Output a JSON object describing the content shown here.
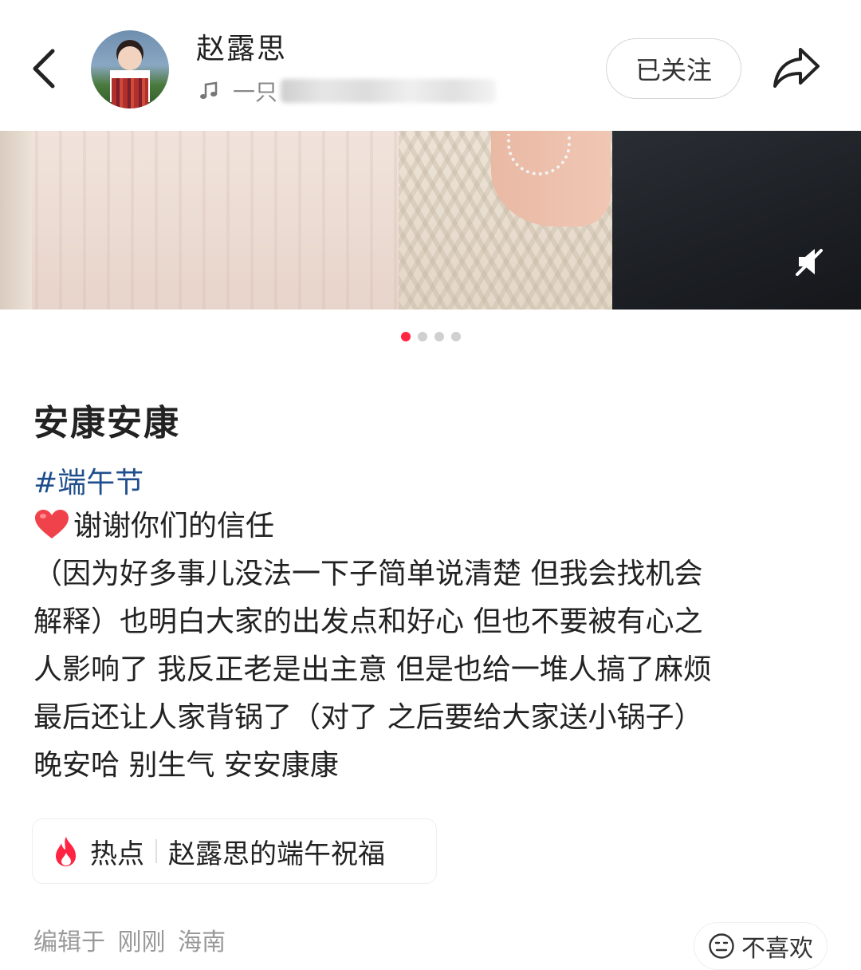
{
  "header": {
    "username": "赵露思",
    "music_prefix": "一只",
    "follow_label": "已关注"
  },
  "carousel": {
    "total": 4,
    "active_index": 0
  },
  "post": {
    "title": "安康安康",
    "hashtag": "#端午节",
    "lines": [
      "谢谢你们的信任",
      "（因为好多事儿没法一下子简单说清楚 但我会找机会",
      "解释）也明白大家的出发点和好心 但也不要被有心之",
      "人影响了 我反正老是出主意 但是也给一堆人搞了麻烦",
      "最后还让人家背锅了（对了 之后要给大家送小锅子）",
      "晚安哈 别生气 安安康康"
    ]
  },
  "hot": {
    "label": "热点",
    "topic": "赵露思的端午祝福"
  },
  "meta": {
    "text": "编辑于 刚刚 海南"
  },
  "dislike": {
    "label": "不喜欢"
  },
  "colors": {
    "accent": "#ff2442",
    "hashtag": "#1f4e8c"
  },
  "icons": [
    "back-arrow-icon",
    "music-note-icon",
    "share-icon",
    "mute-icon",
    "heart-icon",
    "fire-icon",
    "unhappy-face-icon"
  ]
}
